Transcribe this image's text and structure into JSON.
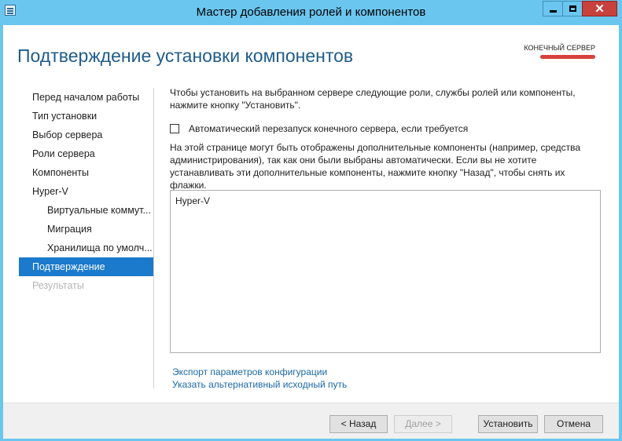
{
  "window": {
    "title": "Мастер добавления ролей и компонентов",
    "controls": {
      "minimize": "minimize",
      "maximize": "maximize",
      "close": "✕"
    }
  },
  "header": {
    "page_title": "Подтверждение установки компонентов",
    "server_label": "КОНЕЧНЫЙ СЕРВЕР"
  },
  "sidebar": {
    "items": [
      {
        "label": "Перед началом работы",
        "state": "normal",
        "level": 0
      },
      {
        "label": "Тип установки",
        "state": "normal",
        "level": 0
      },
      {
        "label": "Выбор сервера",
        "state": "normal",
        "level": 0
      },
      {
        "label": "Роли сервера",
        "state": "normal",
        "level": 0
      },
      {
        "label": "Компоненты",
        "state": "normal",
        "level": 0
      },
      {
        "label": "Hyper-V",
        "state": "normal",
        "level": 0
      },
      {
        "label": "Виртуальные коммут...",
        "state": "normal",
        "level": 1
      },
      {
        "label": "Миграция",
        "state": "normal",
        "level": 1
      },
      {
        "label": "Хранилища по умолч...",
        "state": "normal",
        "level": 1
      },
      {
        "label": "Подтверждение",
        "state": "active",
        "level": 0
      },
      {
        "label": "Результаты",
        "state": "disabled",
        "level": 0
      }
    ]
  },
  "main": {
    "intro": "Чтобы установить на выбранном сервере следующие роли, службы ролей или компоненты, нажмите кнопку \"Установить\".",
    "restart_checkbox": {
      "label": "Автоматический перезапуск конечного сервера, если требуется",
      "checked": false
    },
    "note": "На этой странице могут быть отображены дополнительные компоненты (например, средства администрирования), так как они были выбраны автоматически. Если вы не хотите устанавливать эти дополнительные компоненты, нажмите кнопку \"Назад\", чтобы снять их флажки.",
    "selection_list": [
      "Hyper-V"
    ],
    "links": {
      "export": "Экспорт параметров конфигурации",
      "alt_source": "Указать альтернативный исходный путь"
    }
  },
  "footer": {
    "back": "< Назад",
    "next": "Далее >",
    "install": "Установить",
    "cancel": "Отмена"
  },
  "colors": {
    "titlebar": "#6bc6ef",
    "accent": "#1b7acc",
    "page_title": "#1f5c8a",
    "close_button": "#c7413d",
    "redaction": "#d8413c"
  }
}
